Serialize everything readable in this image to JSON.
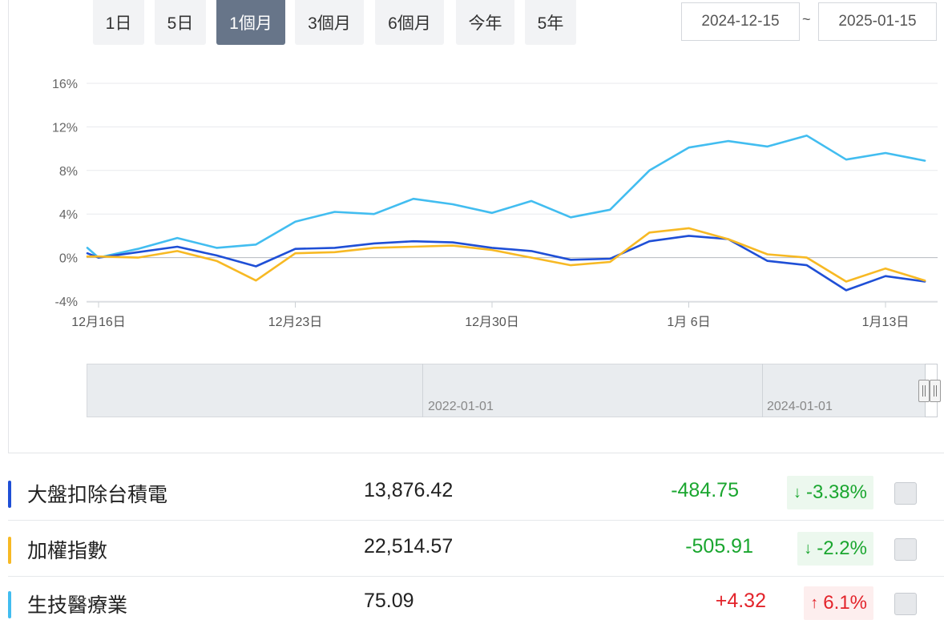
{
  "range_buttons": [
    {
      "label": "1日",
      "active": false
    },
    {
      "label": "5日",
      "active": false
    },
    {
      "label": "1個月",
      "active": true
    },
    {
      "label": "3個月",
      "active": false
    },
    {
      "label": "6個月",
      "active": false
    },
    {
      "label": "今年",
      "active": false
    },
    {
      "label": "5年",
      "active": false
    }
  ],
  "date_range": {
    "start": "2024-12-15",
    "separator": "~",
    "end": "2025-01-15"
  },
  "navigator": {
    "labels": [
      "2022-01-01",
      "2024-01-01"
    ]
  },
  "chart_data": {
    "type": "line",
    "yticks": [
      "16%",
      "12%",
      "8%",
      "4%",
      "0%",
      "-4%"
    ],
    "ylim": [
      -4,
      16
    ],
    "xticks": [
      {
        "label": "12月16日",
        "day": 1
      },
      {
        "label": "12月23日",
        "day": 8
      },
      {
        "label": "12月30日",
        "day": 15
      },
      {
        "label": "1月 6日",
        "day": 22
      },
      {
        "label": "1月13日",
        "day": 29
      }
    ],
    "grid": true,
    "series": [
      {
        "name": "生技醫療業",
        "color": "#42bdf0",
        "points": [
          [
            0.6,
            0.9
          ],
          [
            1,
            0.0
          ],
          [
            2.4,
            0.8
          ],
          [
            3.8,
            1.8
          ],
          [
            5.2,
            0.9
          ],
          [
            6.6,
            1.2
          ],
          [
            8,
            3.3
          ],
          [
            9.4,
            4.2
          ],
          [
            10.8,
            4.0
          ],
          [
            12.2,
            5.4
          ],
          [
            13.6,
            4.9
          ],
          [
            15,
            4.1
          ],
          [
            16.4,
            5.2
          ],
          [
            17.8,
            3.7
          ],
          [
            19.2,
            4.4
          ],
          [
            20.6,
            8.0
          ],
          [
            22,
            10.1
          ],
          [
            23.4,
            10.7
          ],
          [
            24.8,
            10.2
          ],
          [
            26.2,
            11.2
          ],
          [
            27.6,
            9.0
          ],
          [
            29,
            9.6
          ],
          [
            30.4,
            8.9
          ]
        ]
      },
      {
        "name": "大盤扣除台積電",
        "color": "#1f4fd6",
        "points": [
          [
            0.6,
            0.4
          ],
          [
            1,
            0.0
          ],
          [
            2.4,
            0.5
          ],
          [
            3.8,
            1.0
          ],
          [
            5.2,
            0.2
          ],
          [
            6.6,
            -0.8
          ],
          [
            8,
            0.8
          ],
          [
            9.4,
            0.9
          ],
          [
            10.8,
            1.3
          ],
          [
            12.2,
            1.5
          ],
          [
            13.6,
            1.4
          ],
          [
            15,
            0.9
          ],
          [
            16.4,
            0.6
          ],
          [
            17.8,
            -0.2
          ],
          [
            19.2,
            -0.1
          ],
          [
            20.6,
            1.5
          ],
          [
            22,
            2.0
          ],
          [
            23.4,
            1.7
          ],
          [
            24.8,
            -0.3
          ],
          [
            26.2,
            -0.7
          ],
          [
            27.6,
            -3.0
          ],
          [
            29,
            -1.7
          ],
          [
            30.4,
            -2.2
          ]
        ]
      },
      {
        "name": "加權指數",
        "color": "#f7b924",
        "points": [
          [
            0.6,
            0.1
          ],
          [
            1,
            0.1
          ],
          [
            2.4,
            0.0
          ],
          [
            3.8,
            0.6
          ],
          [
            5.2,
            -0.3
          ],
          [
            6.6,
            -2.1
          ],
          [
            8,
            0.4
          ],
          [
            9.4,
            0.5
          ],
          [
            10.8,
            0.9
          ],
          [
            12.2,
            1.0
          ],
          [
            13.6,
            1.1
          ],
          [
            15,
            0.7
          ],
          [
            16.4,
            0.0
          ],
          [
            17.8,
            -0.7
          ],
          [
            19.2,
            -0.4
          ],
          [
            20.6,
            2.3
          ],
          [
            22,
            2.7
          ],
          [
            23.4,
            1.7
          ],
          [
            24.8,
            0.3
          ],
          [
            26.2,
            0.0
          ],
          [
            27.6,
            -2.2
          ],
          [
            29,
            -1.0
          ],
          [
            30.4,
            -2.1
          ]
        ]
      }
    ]
  },
  "rows": [
    {
      "name": "大盤扣除台積電",
      "color": "#1f4fd6",
      "value": "13,876.42",
      "change": "-484.75",
      "pct": "-3.38%",
      "arrow": "↓",
      "dir": "down"
    },
    {
      "name": "加權指數",
      "color": "#f7b924",
      "value": "22,514.57",
      "change": "-505.91",
      "pct": "-2.2%",
      "arrow": "↓",
      "dir": "down"
    },
    {
      "name": "生技醫療業",
      "color": "#42bdf0",
      "value": "75.09",
      "change": "+4.32",
      "pct": "6.1%",
      "arrow": "↑",
      "dir": "up"
    }
  ]
}
